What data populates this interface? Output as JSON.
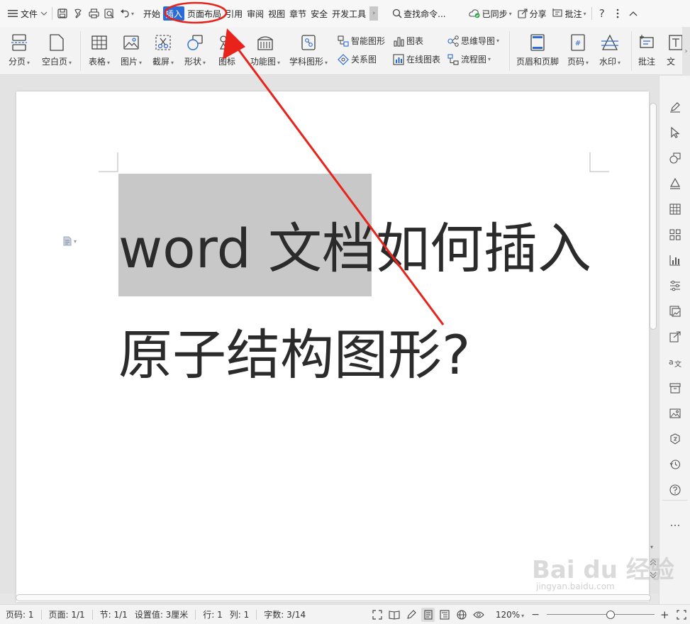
{
  "menubar": {
    "file_label": "文件",
    "tabs": [
      {
        "label": "开始",
        "active": false
      },
      {
        "label": "插入",
        "active": true
      },
      {
        "label": "页面布局",
        "active": false
      },
      {
        "label": "引用",
        "active": false
      },
      {
        "label": "审阅",
        "active": false
      },
      {
        "label": "视图",
        "active": false
      },
      {
        "label": "章节",
        "active": false
      },
      {
        "label": "安全",
        "active": false
      },
      {
        "label": "开发工具",
        "active": false
      }
    ],
    "search_label": "查找命令...",
    "sync_label": "已同步",
    "share_label": "分享",
    "comment_label": "批注"
  },
  "ribbon": {
    "page_break": "分页",
    "blank_page": "空白页",
    "table": "表格",
    "picture": "图片",
    "screenshot": "截屏",
    "shape": "形状",
    "icon": "图标",
    "function_chart": "功能图",
    "science_shape": "学科图形",
    "smart_art": "智能图形",
    "chart": "图表",
    "mind_map": "思维导图",
    "relation_chart": "关系图",
    "online_chart": "在线图表",
    "flow_chart": "流程图",
    "header_footer": "页眉和页脚",
    "page_number": "页码",
    "watermark": "水印",
    "comment": "批注",
    "text_cut": "文"
  },
  "document": {
    "line1": "word 文档如何插入",
    "line2": "原子结构图形?"
  },
  "statusbar": {
    "page_num": "页码: 1",
    "pages": "页面: 1/1",
    "section": "节: 1/1",
    "setting": "设置值: 3厘米",
    "row": "行: 1",
    "col": "列: 1",
    "words": "字数: 3/14",
    "zoom": "120%"
  },
  "watermark": {
    "brand": "Bai du 经验",
    "url": "jingyan.baidu.com"
  },
  "colors": {
    "accent": "#2b6bd8",
    "annotation": "#e8231b"
  }
}
